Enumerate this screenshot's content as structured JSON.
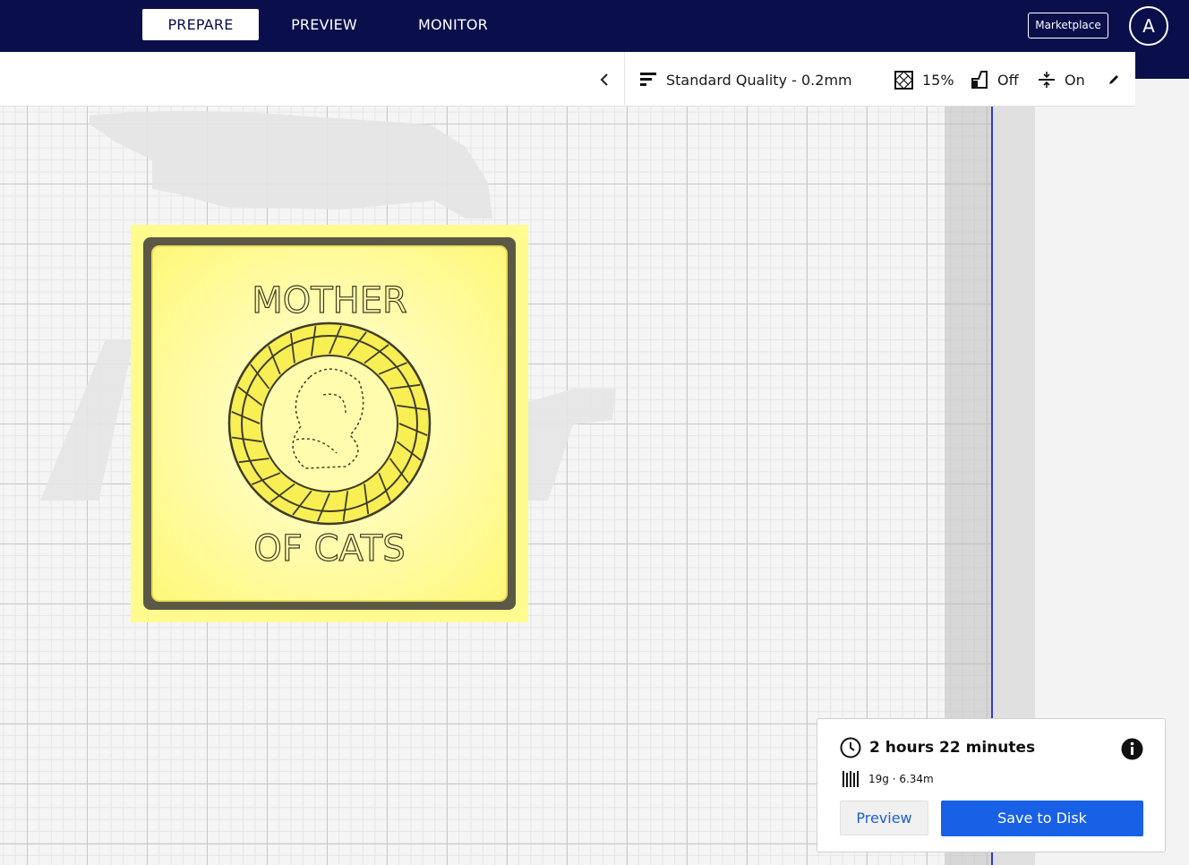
{
  "stages": [
    "PREPARE",
    "PREVIEW",
    "MONITOR"
  ],
  "header": {
    "marketplace_label": "Marketplace",
    "account_initial": "A"
  },
  "print_settings": {
    "profile": "Standard Quality - 0.2mm",
    "infill": "15%",
    "support": "Off",
    "adhesion": "On"
  },
  "model": {
    "text_top": "MOTHER",
    "text_bottom": "OF CATS"
  },
  "print_panel": {
    "time": "2 hours 22 minutes",
    "material": "19g · 6.34m",
    "preview_label": "Preview",
    "save_label": "Save to Disk"
  },
  "colors": {
    "topbar": "#0a0f4c",
    "accent": "#1860e6",
    "model": "#fffb8a"
  },
  "icons": [
    "chevron-left-icon",
    "profile-icon",
    "infill-icon",
    "support-icon",
    "adhesion-icon",
    "pencil-icon",
    "clock-icon",
    "info-icon",
    "filament-icon"
  ]
}
